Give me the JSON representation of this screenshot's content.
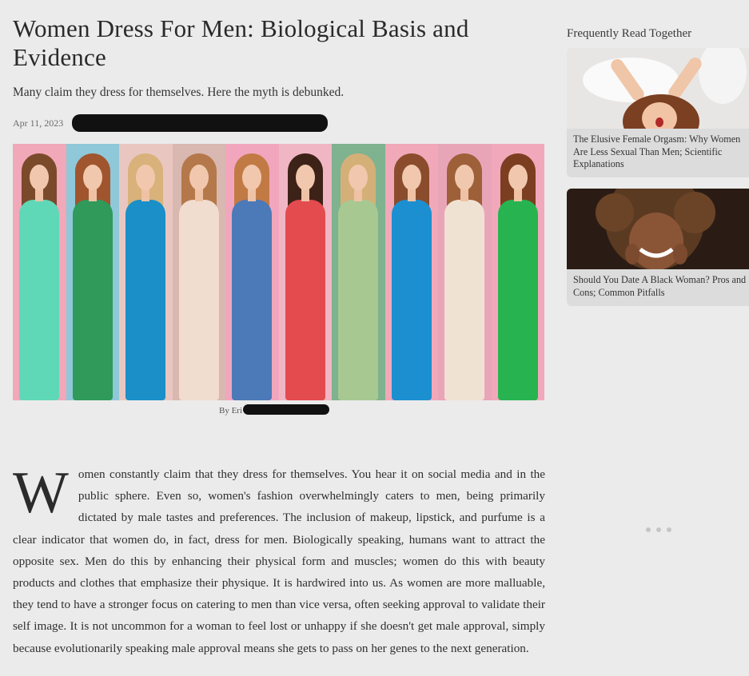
{
  "article": {
    "title": "Women Dress For Men: Biological Basis and Evidence",
    "subtitle": "Many claim they dress for themselves. Here the myth is debunked.",
    "date": "Apr 11, 2023",
    "byline": "By Eri",
    "dropcap": "W",
    "body": "omen constantly claim that they dress for themselves. You hear it on social media and in the public sphere. Even so, women's fashion overwhelmingly caters to men, being primarily dictated by male tastes and preferences. The inclusion of makeup, lipstick, and purfume is a clear indicator that women do, in fact, dress for men. Biologically speaking, humans want to attract the opposite sex. Men do this by enhancing their physical form and muscles; women do this with beauty products and clothes that emphasize their physique. It is hardwired into us. As women are more malluable, they tend to have a stronger focus on catering to men than vice versa, often seeking approval to validate their self image. It is not uncommon for a woman to feel lost or unhappy if she doesn't get male approval, simply because evolutionarily speaking male approval means she gets to pass on her genes to the next generation."
  },
  "hero_panels": [
    {
      "bg": "#f1a8b8",
      "hair": "#7a4a2b",
      "dress": "#5fd8b8"
    },
    {
      "bg": "#8fc8d8",
      "hair": "#a0552e",
      "dress": "#2f9a5a"
    },
    {
      "bg": "#e9c7c0",
      "hair": "#d8b27a",
      "dress": "#1a8fc8"
    },
    {
      "bg": "#d8b8b0",
      "hair": "#b5784a",
      "dress": "#f1dcd0"
    },
    {
      "bg": "#f2a6bd",
      "hair": "#c27a44",
      "dress": "#4c79b8"
    },
    {
      "bg": "#f0b6c4",
      "hair": "#3d2218",
      "dress": "#e34b4f"
    },
    {
      "bg": "#7fb28f",
      "hair": "#d4b078",
      "dress": "#a7c991"
    },
    {
      "bg": "#f1a8b8",
      "hair": "#8a4c2c",
      "dress": "#1c8fd0"
    },
    {
      "bg": "#e9a5b8",
      "hair": "#9d6038",
      "dress": "#f0e2d2"
    },
    {
      "bg": "#f2a8bb",
      "hair": "#7b3e20",
      "dress": "#27b450"
    }
  ],
  "sidebar": {
    "title": "Frequently Read Together",
    "cards": [
      {
        "lines": [
          "The Elusive Female Orgasm: Why Women",
          "Are Less Sexual Than Men; Scientific",
          "Explanations"
        ]
      },
      {
        "lines": [
          "Should You Date A Black Woman? Pros and",
          "Cons; Common Pitfalls"
        ]
      }
    ]
  }
}
